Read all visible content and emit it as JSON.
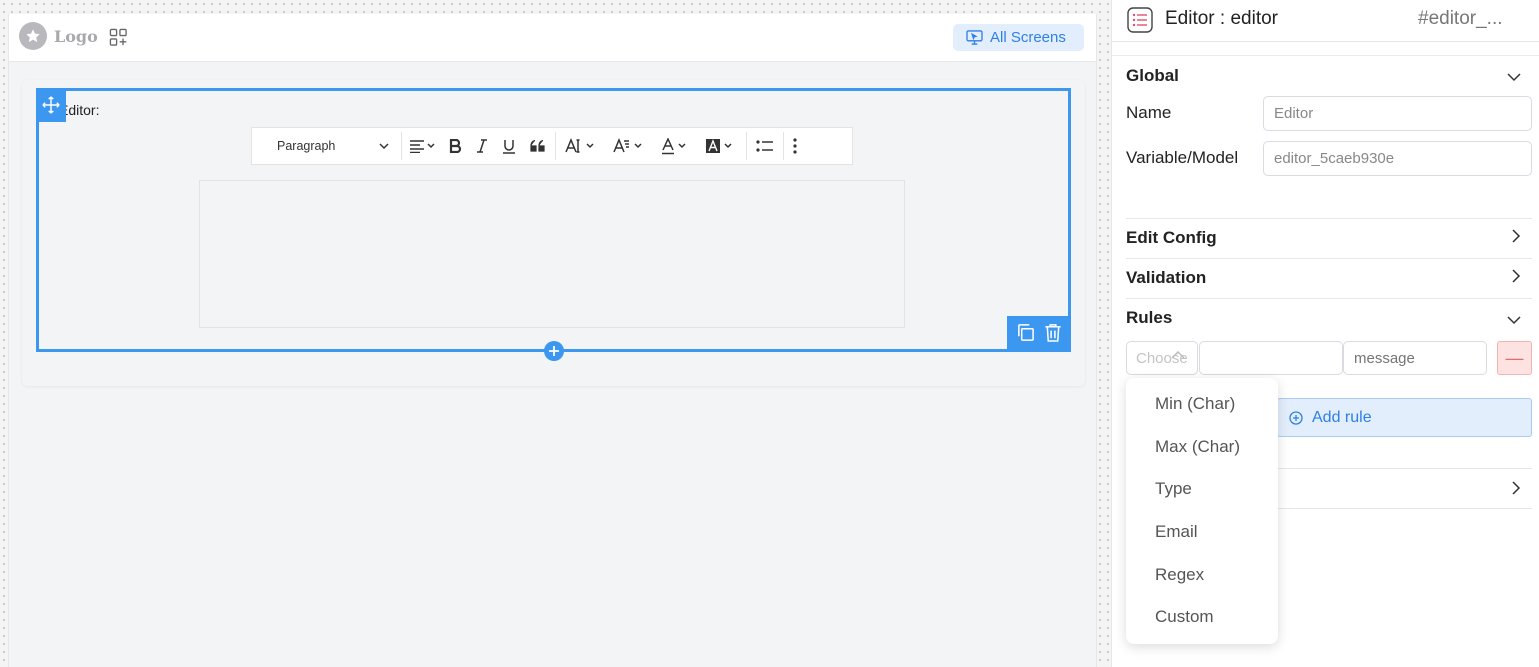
{
  "topbar": {
    "logo_text": "Logo",
    "all_screens_label": "All Screens"
  },
  "canvas": {
    "field_label": "Editor:",
    "toolbar": {
      "paragraph_label": "Paragraph"
    }
  },
  "panel": {
    "title": "Editor : editor",
    "element_id": "#editor_...",
    "sections": {
      "global": "Global",
      "edit_config": "Edit Config",
      "validation": "Validation",
      "rules": "Rules"
    },
    "global": {
      "name_label": "Name",
      "name_value": "Editor",
      "model_label": "Variable/Model",
      "model_value": "editor_5caeb930e"
    },
    "rules": {
      "select_placeholder": "Choose",
      "message_placeholder": "message",
      "remove_symbol": "—",
      "add_rule_label": "Add rule",
      "options": [
        "Min (Char)",
        "Max (Char)",
        "Type",
        "Email",
        "Regex",
        "Custom"
      ]
    }
  },
  "colors": {
    "accent": "#3b97f0",
    "link_blue": "#2f7fe8",
    "danger_bg": "#fde2e2"
  }
}
